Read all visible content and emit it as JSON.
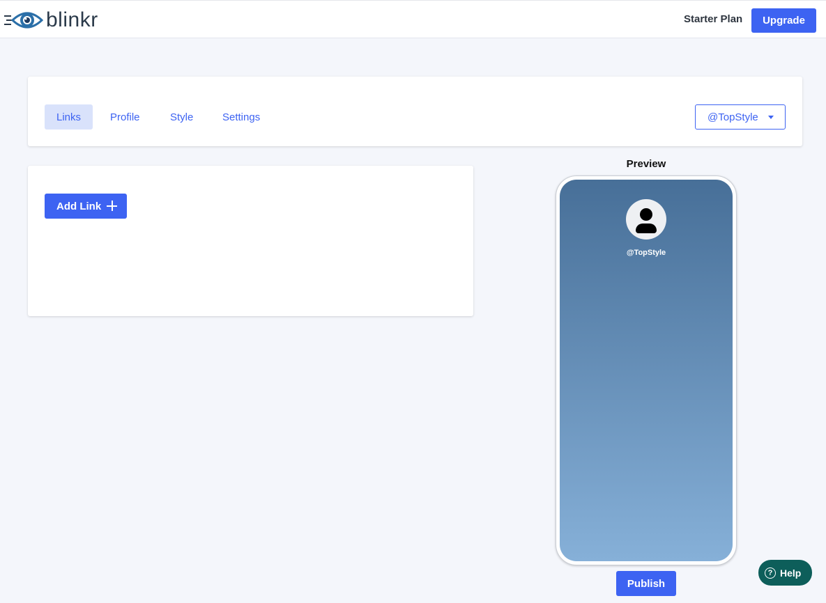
{
  "header": {
    "brand": "blinkr",
    "plan_label": "Starter Plan",
    "upgrade_label": "Upgrade"
  },
  "tabs": [
    {
      "label": "Links",
      "active": true
    },
    {
      "label": "Profile",
      "active": false
    },
    {
      "label": "Style",
      "active": false
    },
    {
      "label": "Settings",
      "active": false
    }
  ],
  "account_selector": {
    "value": "@TopStyle"
  },
  "links_panel": {
    "add_link_label": "Add Link"
  },
  "preview": {
    "title": "Preview",
    "handle": "@TopStyle",
    "gradient_top": "#476f98",
    "gradient_bottom": "#86b0d8"
  },
  "publish_label": "Publish",
  "help": {
    "label": "Help",
    "icon_glyph": "?"
  },
  "colors": {
    "accent": "#3d63f2",
    "help_bg": "#0d5e5a",
    "page_bg": "#f4f6fb"
  }
}
